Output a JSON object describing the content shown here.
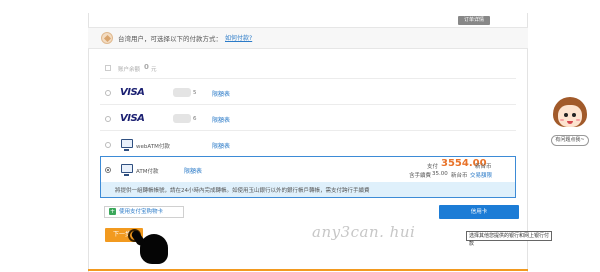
{
  "order_tab": "订单详情",
  "header": {
    "text": "台湾用户，可选择以下的付款方式：",
    "link": "如何付款?"
  },
  "balance": {
    "label": "账户余额",
    "amount": "0",
    "unit": "元"
  },
  "methods": [
    {
      "name": "VISA",
      "digit": "5",
      "link": "限額表"
    },
    {
      "name": "VISA",
      "digit": "6",
      "link": "限額表"
    },
    {
      "name": "webATM付款",
      "link": "限額表"
    },
    {
      "name": "ATM付款",
      "link": "限額表"
    }
  ],
  "atm": {
    "pay_label": "支付",
    "amount": "3554.00",
    "currency": "新台币",
    "fee_label": "含手續費",
    "fee_amount": "35.00",
    "fee_currency": "新台币",
    "trade_limit_link": "交易額限",
    "info": "將提供一組轉帳帳號，請在24小時內完成轉帳。如使用玉山銀行以外的銀行帳戶轉帳，需支付跨行手續費"
  },
  "buttons": {
    "friend_pay": "使用支付宝购物卡",
    "credit_card": "信用卡",
    "next": "下一步"
  },
  "tooltip": "选择其他您提供的银行和网上银行付款",
  "watermark": "any3can. hui",
  "help": "有问题点我~",
  "colors": {
    "accent_orange": "#f29a1f",
    "link_blue": "#2b7bc8",
    "button_blue": "#1c7cd6",
    "price_orange": "#e8732a",
    "info_bg": "#dff0fb"
  }
}
